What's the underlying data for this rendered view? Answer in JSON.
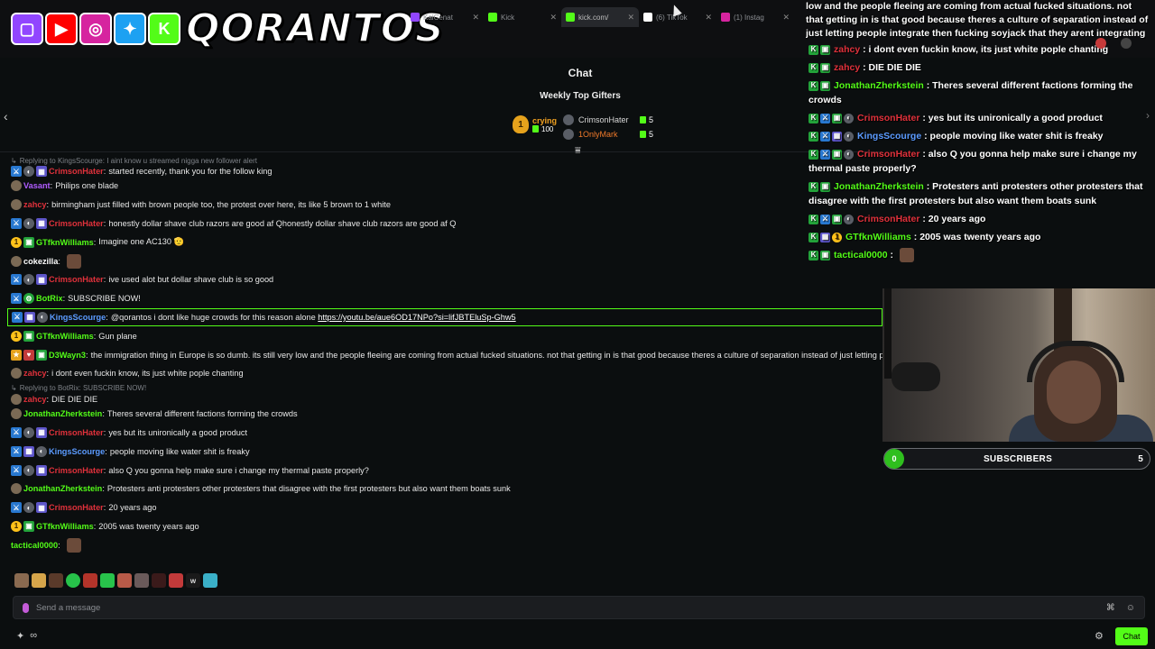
{
  "brand": {
    "name": "QORANTOS",
    "socials": [
      {
        "icon": "twitch-icon",
        "color": "#9146ff"
      },
      {
        "icon": "youtube-icon",
        "color": "#ff0000"
      },
      {
        "icon": "instagram-icon",
        "color": "#d6249f"
      },
      {
        "icon": "twitter-icon",
        "color": "#1da1f2"
      },
      {
        "icon": "kick-icon",
        "color": "#53fc18"
      }
    ]
  },
  "tabs": [
    {
      "label": "KaiCenat",
      "color": "#9146ff"
    },
    {
      "label": "Kick",
      "color": "#53fc18"
    },
    {
      "label": "kick.com/",
      "color": "#53fc18"
    },
    {
      "label": "(6) TikTok",
      "color": "#ffffff"
    },
    {
      "label": "(1) Instag",
      "color": "#d6249f"
    }
  ],
  "chat": {
    "title": "Chat",
    "weekly_title": "Weekly Top Gifters",
    "top_gifter": {
      "rank": "1",
      "name": "crying",
      "count": "100"
    },
    "gifters": [
      {
        "name": "CrimsonHater",
        "count": "5",
        "color": "#d8d8d8"
      },
      {
        "name": "1OnlyMark",
        "count": "5",
        "color": "#f07a2a"
      }
    ],
    "input_placeholder": "Send a message",
    "chat_button": "Chat"
  },
  "messages": [
    {
      "type": "reply",
      "text": "Replying to KingsScourge: I aint know u streamed nigga new follower alert"
    },
    {
      "user": "CrimsonHater",
      "color": "#e0313b",
      "badges": [
        "mod",
        "og",
        "sub"
      ],
      "text": "started recently, thank you for the follow king",
      "tight": true
    },
    {
      "user": "Vasant",
      "color": "#b05cff",
      "badges": [
        "avatar"
      ],
      "text": "Philips one blade"
    },
    {
      "user": "zahcy",
      "color": "#e0313b",
      "badges": [
        "avatar"
      ],
      "text": "birmingham just filled with brown people too, the protest over here, its like 5 brown to 1 white"
    },
    {
      "user": "CrimsonHater",
      "color": "#e0313b",
      "badges": [
        "mod",
        "og",
        "sub"
      ],
      "text": "honestly dollar shave club razors are good af Qhonestly dollar shave club razors are good af Q"
    },
    {
      "user": "GTfknWilliams",
      "color": "#53fc18",
      "badges": [
        "gift",
        "green"
      ],
      "text": "Imagine one AC130 🫡"
    },
    {
      "user": "cokezilla",
      "color": "#ffffff",
      "badges": [
        "avatar"
      ],
      "text": "",
      "emote": true
    },
    {
      "user": "CrimsonHater",
      "color": "#e0313b",
      "badges": [
        "mod",
        "og",
        "sub"
      ],
      "text": "ive used alot but dollar shave club is so good"
    },
    {
      "user": "BotRix",
      "color": "#53fc18",
      "badges": [
        "mod",
        "bot"
      ],
      "text": "SUBSCRIBE NOW!"
    },
    {
      "user": "KingsScourge",
      "color": "#5b9bff",
      "badges": [
        "mod",
        "sub",
        "og"
      ],
      "text": "@qorantos i dont like huge crowds for this reason alone ",
      "link": "https://youtu.be/aue6OD17NPo?si=lifJBTEluSp-Ghw5",
      "highlight": true
    },
    {
      "user": "GTfknWilliams",
      "color": "#53fc18",
      "badges": [
        "gift",
        "green"
      ],
      "text": "Gun plane"
    },
    {
      "user": "D3Wayn3",
      "color": "#53fc18",
      "badges": [
        "yellow",
        "red",
        "green"
      ],
      "text": "the immigration thing in Europe is so dumb. its still very low and the people fleeing are coming from actual fucked situations. not that getting in is that good because theres a culture of separation instead of just letting people integrate"
    },
    {
      "user": "zahcy",
      "color": "#e0313b",
      "badges": [
        "avatar"
      ],
      "text": "i dont even fuckin know, its just white pople chanting"
    },
    {
      "type": "reply",
      "text": "Replying to BotRix: SUBSCRIBE NOW!"
    },
    {
      "user": "zahcy",
      "color": "#e0313b",
      "badges": [
        "avatar"
      ],
      "text": "DIE DIE DIE",
      "tight": true
    },
    {
      "user": "JonathanZherkstein",
      "color": "#53fc18",
      "badges": [
        "avatar"
      ],
      "text": "Theres several different factions forming the crowds"
    },
    {
      "user": "CrimsonHater",
      "color": "#e0313b",
      "badges": [
        "mod",
        "og",
        "sub"
      ],
      "text": "yes but its unironically a good product"
    },
    {
      "user": "KingsScourge",
      "color": "#5b9bff",
      "badges": [
        "mod",
        "sub",
        "og"
      ],
      "text": "people moving like water shit is freaky"
    },
    {
      "user": "CrimsonHater",
      "color": "#e0313b",
      "badges": [
        "mod",
        "og",
        "sub"
      ],
      "text": "also Q you gonna help make sure i change my thermal paste properly?"
    },
    {
      "user": "JonathanZherkstein",
      "color": "#53fc18",
      "badges": [
        "avatar"
      ],
      "text": "Protesters anti protesters other protesters that disagree with the first protesters but also want them boats sunk"
    },
    {
      "user": "CrimsonHater",
      "color": "#e0313b",
      "badges": [
        "mod",
        "og",
        "sub"
      ],
      "text": "20 years ago"
    },
    {
      "user": "GTfknWilliams",
      "color": "#53fc18",
      "badges": [
        "gift",
        "green"
      ],
      "text": "2005 was twenty years ago"
    },
    {
      "user": "tactical0000",
      "color": "#53fc18",
      "badges": [],
      "text": "",
      "emote": true
    }
  ],
  "overlay": {
    "top_lines": [
      "low and the people fleeing are coming from actual fucked situations. not",
      "that getting in is that good because theres a culture of separation instead of",
      "just letting people integrate then fucking soyjack that they arent integrating"
    ],
    "messages": [
      {
        "user": "zahcy",
        "color": "#e0313b",
        "badges": [
          "kick",
          "green"
        ],
        "text": "i dont even fuckin know, its just white pople chanting"
      },
      {
        "user": "zahcy",
        "color": "#e0313b",
        "badges": [
          "kick",
          "green"
        ],
        "text": "DIE DIE DIE"
      },
      {
        "user": "JonathanZherkstein",
        "color": "#53fc18",
        "badges": [
          "kick",
          "green"
        ],
        "text": "Theres several different factions forming the crowds"
      },
      {
        "user": "CrimsonHater",
        "color": "#e0313b",
        "badges": [
          "kick",
          "mod",
          "green",
          "og"
        ],
        "text": "yes but its unironically a good product"
      },
      {
        "user": "KingsScourge",
        "color": "#5b9bff",
        "badges": [
          "kick",
          "mod",
          "sub",
          "og"
        ],
        "text": "people moving like water shit is freaky"
      },
      {
        "user": "CrimsonHater",
        "color": "#e0313b",
        "badges": [
          "kick",
          "mod",
          "green",
          "og"
        ],
        "text": "also Q you gonna help make sure i change my thermal paste properly?"
      },
      {
        "user": "JonathanZherkstein",
        "color": "#53fc18",
        "badges": [
          "kick",
          "green"
        ],
        "text": "Protesters anti protesters other protesters that disagree with the first protesters but also want them boats sunk"
      },
      {
        "user": "CrimsonHater",
        "color": "#e0313b",
        "badges": [
          "kick",
          "mod",
          "green",
          "og"
        ],
        "text": "20 years ago"
      },
      {
        "user": "GTfknWilliams",
        "color": "#53fc18",
        "badges": [
          "kick",
          "sub",
          "gift"
        ],
        "text": "2005 was twenty years ago"
      },
      {
        "user": "tactical0000",
        "color": "#53fc18",
        "badges": [
          "kick",
          "green"
        ],
        "text": "",
        "emote": true
      }
    ]
  },
  "subscribers": {
    "label": "SUBSCRIBERS",
    "current": "0",
    "goal": "5"
  }
}
